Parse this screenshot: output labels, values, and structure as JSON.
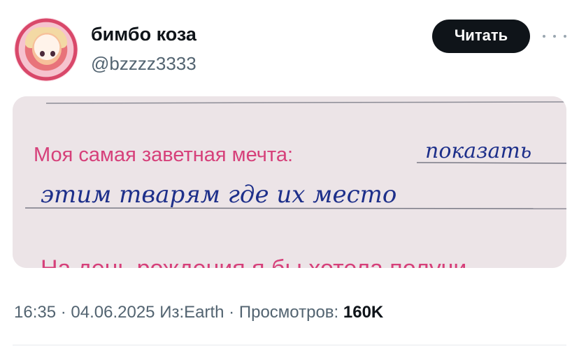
{
  "author": {
    "display_name": "бимбо коза",
    "handle": "@bzzzz3333"
  },
  "actions": {
    "follow_label": "Читать",
    "more_icon": "more-dots-icon"
  },
  "media": {
    "printed_text": "Моя самая заветная мечта:",
    "handwritten_line_1": "показать",
    "handwritten_line_2": "этим тварям где их место",
    "cropped_printed_text": "На день рождения я бы хотела получи"
  },
  "meta": {
    "time": "16:35",
    "separator": "·",
    "date": "04.06.2025",
    "source": "Из:Earth",
    "views_label": "Просмотров:",
    "views_count": "160K"
  },
  "colors": {
    "text_primary": "#0f1419",
    "text_secondary": "#536471",
    "button_bg": "#0f1419",
    "printed_pink": "#d6407a",
    "ink_blue": "#1d2f8a"
  }
}
